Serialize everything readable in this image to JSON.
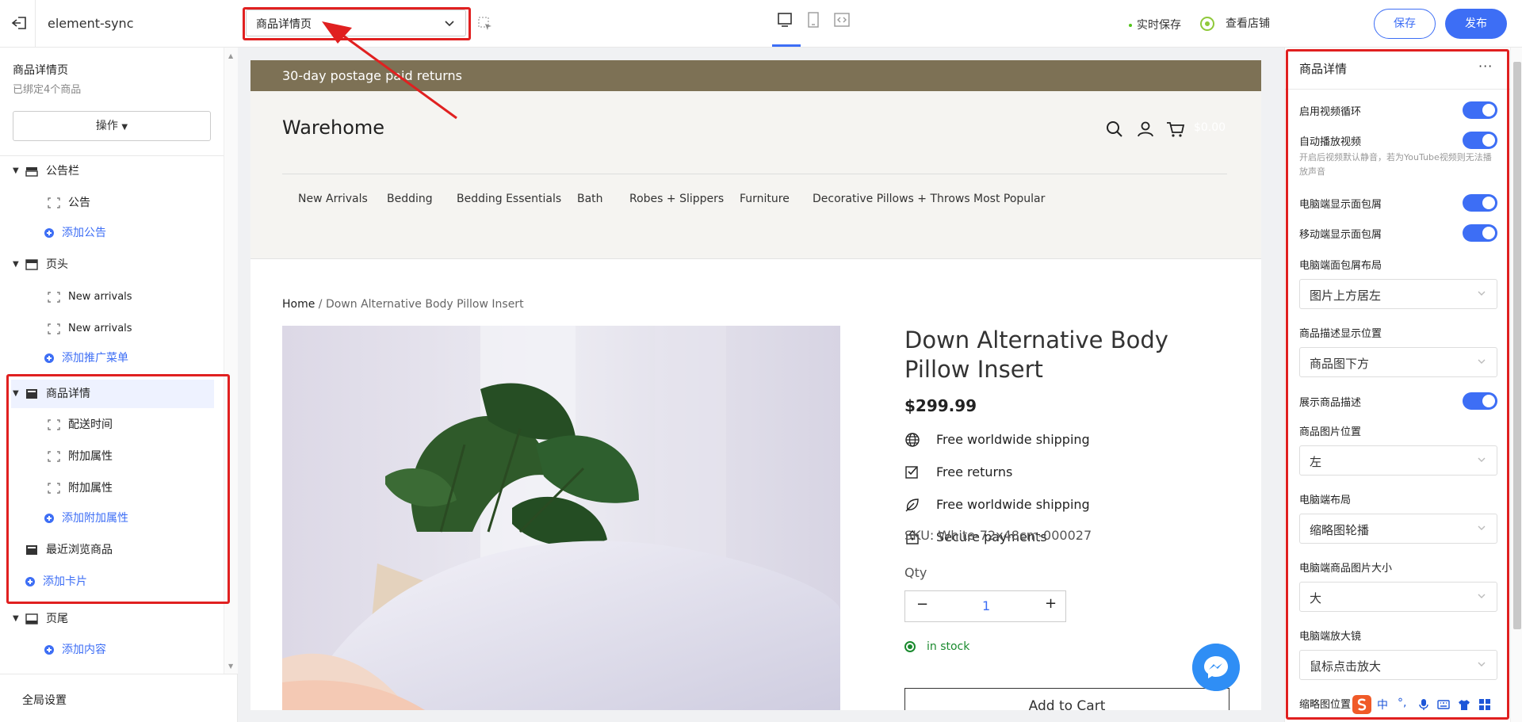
{
  "app": {
    "name": "element-sync"
  },
  "topbar": {
    "page_select": "商品详情页",
    "autosave": "实时保存",
    "view_store": "查看店铺",
    "save": "保存",
    "publish": "发布"
  },
  "left": {
    "title": "商品详情页",
    "subtitle": "已绑定4个商品",
    "op_button": "操作",
    "tree": {
      "announce": "公告栏",
      "announce_child": "公告",
      "add_announce": "添加公告",
      "header": "页头",
      "header_child1": "New arrivals",
      "header_child2": "New arrivals",
      "add_menu": "添加推广菜单",
      "product": "商品详情",
      "product_child1": "配送时间",
      "product_child2": "附加属性",
      "product_child3": "附加属性",
      "add_attr": "添加附加属性",
      "recent": "最近浏览商品",
      "add_card": "添加卡片",
      "footer": "页尾",
      "add_content": "添加内容"
    },
    "global_settings": "全局设置"
  },
  "preview": {
    "announcement": "30-day postage paid returns",
    "logo": "Warehome",
    "cart_amount": "$0.00",
    "nav": [
      "New Arrivals",
      "Bedding",
      "Bedding Essentials",
      "Bath",
      "Robes + Slippers",
      "Furniture",
      "Decorative Pillows + Throws",
      "Most Popular"
    ],
    "breadcrumb_home": "Home",
    "breadcrumb_current": " / Down Alternative Body Pillow Insert",
    "product_title": "Down Alternative Body Pillow Insert",
    "price": "$299.99",
    "features": [
      "Free worldwide shipping",
      "Free returns",
      "Free worldwide shipping",
      "Secure payments"
    ],
    "sku": "SKU: White-72x48cm-000027",
    "qty_label": "Qty",
    "qty_minus": "−",
    "qty_value": "1",
    "qty_plus": "+",
    "stock": "in stock",
    "add_to_cart": "Add to Cart"
  },
  "right": {
    "title": "商品详情",
    "more": "···",
    "video_loop": "启用视频循环",
    "autoplay": "自动播放视频",
    "autoplay_hint": "开启后视频默认静音，若为YouTube视频则无法播放声音",
    "pc_breadcrumb": "电脑端显示面包屑",
    "mobile_breadcrumb": "移动端显示面包屑",
    "pc_breadcrumb_layout": "电脑端面包屑布局",
    "pc_breadcrumb_layout_value": "图片上方居左",
    "desc_position": "商品描述显示位置",
    "desc_position_value": "商品图下方",
    "show_desc": "展示商品描述",
    "img_position": "商品图片位置",
    "img_position_value": "左",
    "pc_layout": "电脑端布局",
    "pc_layout_value": "缩略图轮播",
    "pc_img_size": "电脑端商品图片大小",
    "pc_img_size_value": "大",
    "pc_zoom": "电脑端放大镜",
    "pc_zoom_value": "鼠标点击放大",
    "thumb_position": "缩略图位置"
  },
  "ime": {
    "lang": "中",
    "punct": "°,"
  },
  "colors": {
    "accent": "#3d6ef5",
    "announce_bg": "#7d7155",
    "highlight": "#e02020"
  }
}
